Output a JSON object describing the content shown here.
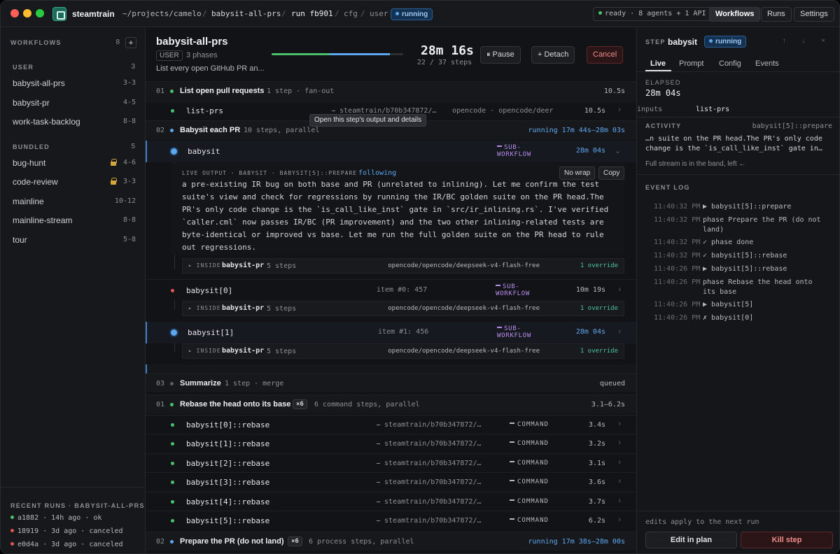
{
  "titlebar": {
    "app_name": "steamtrain",
    "path": "~/projects/camelo",
    "crumb_workflow": "babysit-all-prs",
    "sep": "/",
    "crumb_run": "run fb901",
    "crumb_cfg": "cfg",
    "crumb_user": "user",
    "run_status": "running",
    "system_status": "ready · 8 agents + 1 API",
    "nav": [
      "Workflows",
      "Runs",
      "Settings"
    ]
  },
  "sidebar": {
    "workflows_label": "WORKFLOWS",
    "workflows_count": "8",
    "add": "+",
    "user_label": "USER",
    "user_count": "3",
    "user_items": [
      {
        "name": "babysit-all-prs",
        "meta": "3-3"
      },
      {
        "name": "babysit-pr",
        "meta": "4-5"
      },
      {
        "name": "work-task-backlog",
        "meta": "8-8"
      }
    ],
    "bundled_label": "BUNDLED",
    "bundled_count": "5",
    "bundled_items": [
      {
        "name": "bug-hunt",
        "meta": "4-6"
      },
      {
        "name": "code-review",
        "meta": "3-3"
      },
      {
        "name": "mainline",
        "meta": "10-12"
      },
      {
        "name": "mainline-stream",
        "meta": "8-8"
      },
      {
        "name": "tour",
        "meta": "5-8"
      }
    ],
    "recent_label": "RECENT RUNS · BABYSIT-ALL-PRS",
    "recent": [
      {
        "text": "a1882 · 14h ago · ok",
        "color": "#4ac06d"
      },
      {
        "text": "18919 · 3d ago · canceled",
        "color": "#e0554f"
      },
      {
        "text": "e0d4a · 3d ago · canceled",
        "color": "#e0554f"
      }
    ]
  },
  "header": {
    "title": "babysit-all-prs",
    "badge": "USER",
    "phases": "3 phases",
    "description": "List every open GitHub PR an...",
    "progress_done_fraction": 0.44,
    "progress_running_fraction": 0.46,
    "elapsed": "28m 16s",
    "steps": "22 / 37 steps",
    "pause": "⏸ Pause",
    "detach": "+ Detach",
    "cancel": "Cancel"
  },
  "tooltip": "Open this step's output and details",
  "phases": {
    "p1": {
      "num": "01",
      "title": "List open pull requests",
      "meta": "1 step · fan-out",
      "right": "10.5s"
    },
    "p1_step": {
      "name": "list-prs",
      "cmd": "⎯ steamtrain/b70b347872/…",
      "agent": "opencode · opencode/deer",
      "dur": "10.5s"
    },
    "p2": {
      "num": "02",
      "title": "Babysit each PR",
      "meta": "10 steps, parallel",
      "right": "running 17m 44s–28m 03s"
    },
    "p3": {
      "num": "03",
      "title": "Summarize",
      "meta": "1 step · merge",
      "right": "queued"
    },
    "p4": {
      "num": "01",
      "title": "Rebase the head onto its base",
      "mult": "×6",
      "meta": "6 command steps, parallel",
      "right": "3.1–6.2s"
    },
    "p5": {
      "num": "02",
      "title": "Prepare the PR (do not land)",
      "mult": "×6",
      "meta": "6 process steps, parallel",
      "right": "running 17m 38s–28m 00s"
    }
  },
  "babysit": {
    "name": "babysit",
    "kind_line1": "SUB-",
    "kind_line2": "WORKFLOW",
    "dur": "28m 04s",
    "chev": "⌄",
    "live_label": "LIVE OUTPUT · BABYSIT · BABYSIT[5]::PREPARE",
    "following": "following",
    "nowrap": "No wrap",
    "copy": "Copy",
    "live_text": "a pre-existing IR bug on both base and PR (unrelated to inlining). Let me confirm the test suite's view and check for regressions by running the IR/BC golden suite on the PR head.The PR's only code change is the `is_call_like_inst` gate in `src/ir_inlining.rs`. I've verified `caller.cml` now passes IR/BC (PR improvement) and the two other inlining-related tests are byte-identical or improved vs base. Let me run the full golden suite on the PR head to rule out regressions."
  },
  "inside": {
    "label": "▸ INSIDE",
    "name": "babysit-pr",
    "steps": "5 steps",
    "model": "opencode/opencode/deepseek-v4-flash-free",
    "override": "1 override"
  },
  "sub_rows": [
    {
      "name": "babysit[0]",
      "item": "item #0: 457",
      "dur": "10m 19s"
    },
    {
      "name": "babysit[1]",
      "item": "item #1: 456",
      "dur": "28m 04s"
    }
  ],
  "rebase_rows": [
    {
      "name": "babysit[0]::rebase",
      "dur": "3.4s"
    },
    {
      "name": "babysit[1]::rebase",
      "dur": "3.2s"
    },
    {
      "name": "babysit[2]::rebase",
      "dur": "3.1s"
    },
    {
      "name": "babysit[3]::rebase",
      "dur": "3.6s"
    },
    {
      "name": "babysit[4]::rebase",
      "dur": "3.7s"
    },
    {
      "name": "babysit[5]::rebase",
      "dur": "6.2s"
    }
  ],
  "rebase_cmd": "⎯ steamtrain/b70b347872/…",
  "command_label": "COMMAND",
  "row_chev": "›",
  "right_panel": {
    "step_label": "STEP",
    "step_name": "babysit",
    "status": "running",
    "icons": "↑ ↓ ×",
    "tabs": [
      "Live",
      "Prompt",
      "Config",
      "Events"
    ],
    "elapsed_label": "ELAPSED",
    "elapsed": "28m 04s",
    "inputs_label": "inputs",
    "inputs_value": "list-prs",
    "activity_label": "ACTIVITY",
    "activity_ref": "babysit[5]::prepare",
    "activity_line1": "…n suite on the PR head.The PR's only code",
    "activity_line2": "change is the `is_call_like_inst` gate in…",
    "stream_note": "Full stream is in the band, left ←",
    "log_label": "EVENT LOG",
    "events": [
      {
        "time": "11:40:32 PM",
        "msg": "▶ babysit[5]::prepare"
      },
      {
        "time": "11:40:32 PM",
        "msg": "phase Prepare the PR (do not land)"
      },
      {
        "time": "11:40:32 PM",
        "msg": "✓ phase done"
      },
      {
        "time": "11:40:32 PM",
        "msg": "✓ babysit[5]::rebase"
      },
      {
        "time": "11:40:26 PM",
        "msg": "▶ babysit[5]::rebase"
      },
      {
        "time": "11:40:26 PM",
        "msg": "phase Rebase the head onto its base"
      },
      {
        "time": "11:40:26 PM",
        "msg": "▶ babysit[5]"
      },
      {
        "time": "11:40:26 PM",
        "msg": "✗ babysit[0]"
      }
    ],
    "edits_note": "edits apply to the next run",
    "edit_btn": "Edit in plan",
    "kill_btn": "Kill step"
  },
  "colors": {
    "green": "#4ac06d",
    "blue": "#5ea7ef",
    "red": "#e0554f",
    "purple": "#b98df0",
    "teal": "#4fc1a0"
  }
}
